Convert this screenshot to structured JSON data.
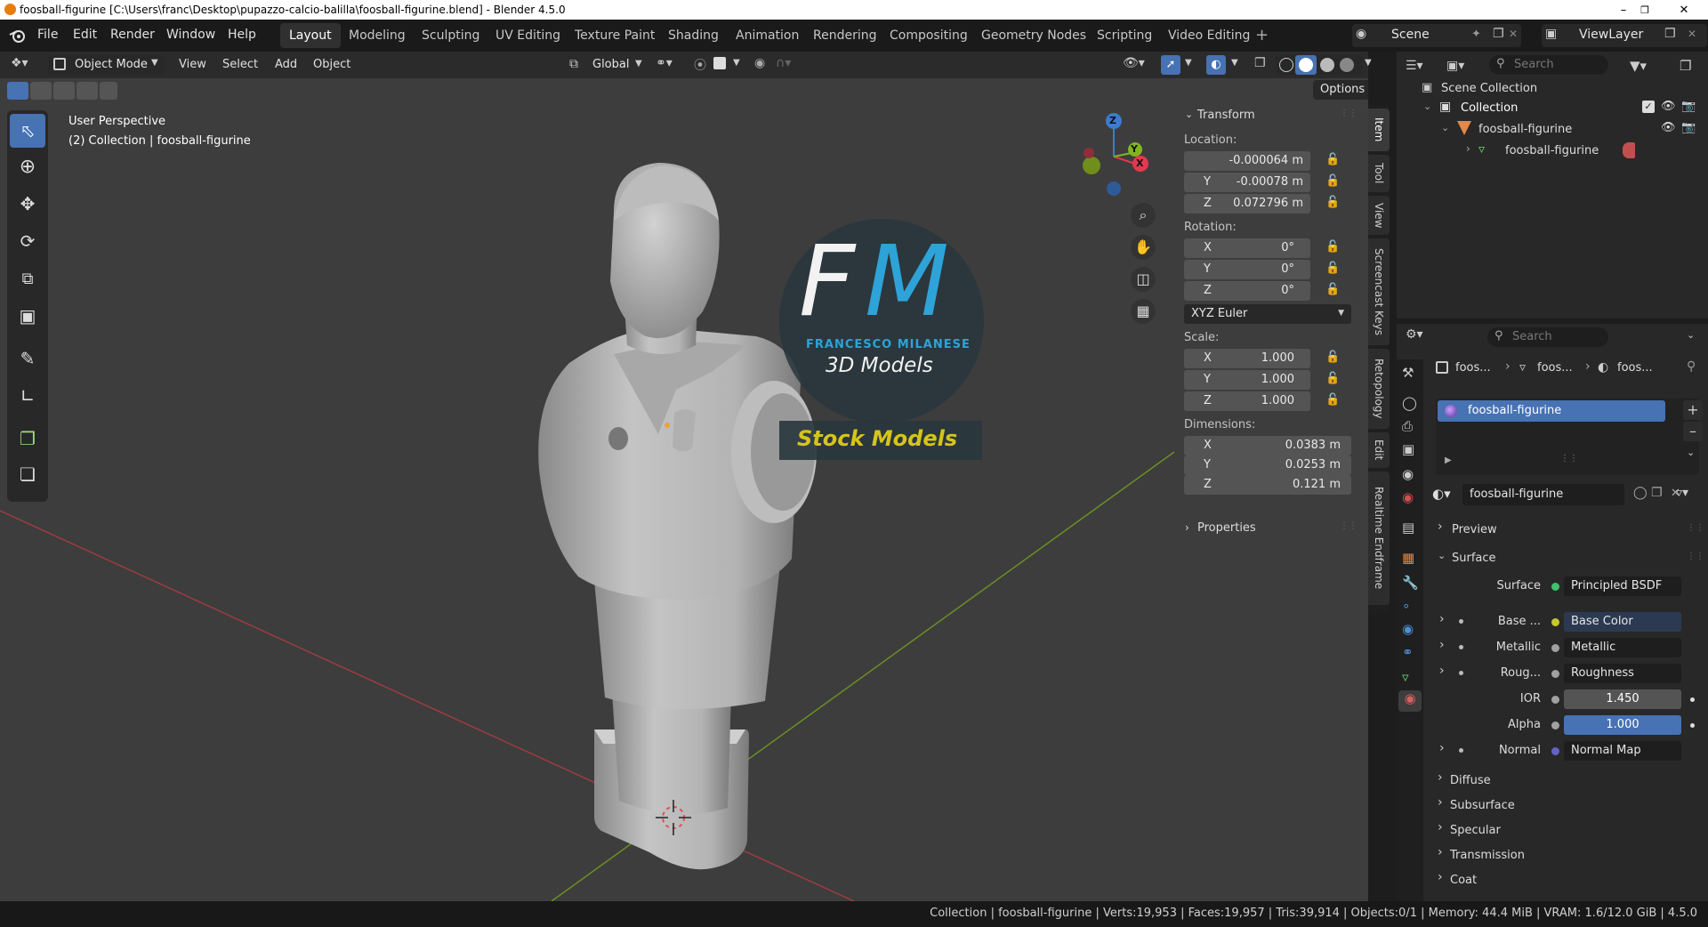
{
  "window": {
    "title": "foosball-figurine [C:\\Users\\franc\\Desktop\\pupazzo-calcio-balilla\\foosball-figurine.blend] - Blender 4.5.0"
  },
  "menu": {
    "items": [
      "File",
      "Edit",
      "Render",
      "Window",
      "Help"
    ]
  },
  "workspaces": [
    "Layout",
    "Modeling",
    "Sculpting",
    "UV Editing",
    "Texture Paint",
    "Shading",
    "Animation",
    "Rendering",
    "Compositing",
    "Geometry Nodes",
    "Scripting",
    "Video Editing"
  ],
  "active_workspace": "Layout",
  "top_right": {
    "scene": "Scene",
    "view_layer": "ViewLayer"
  },
  "viewport_header": {
    "mode": "Object Mode",
    "menus": [
      "View",
      "Select",
      "Add",
      "Object"
    ],
    "orientation": "Global",
    "options": "Options"
  },
  "viewport": {
    "perspective": "User Perspective",
    "collection_info": "(2) Collection | foosball-figurine"
  },
  "gizmo": {
    "x": "X",
    "y": "Y",
    "z": "Z"
  },
  "watermark": {
    "initials_f": "F",
    "initials_m": "M",
    "name": "FRANCESCO MILANESE",
    "subtitle": "3D Models",
    "banner": "Stock Models"
  },
  "npanel": {
    "transform_title": "Transform",
    "location_label": "Location:",
    "location": [
      {
        "axis": "",
        "value": "-0.000064 m"
      },
      {
        "axis": "Y",
        "value": "-0.00078 m"
      },
      {
        "axis": "Z",
        "value": "0.072796 m"
      }
    ],
    "rotation_label": "Rotation:",
    "rotation": [
      {
        "axis": "X",
        "value": "0°"
      },
      {
        "axis": "Y",
        "value": "0°"
      },
      {
        "axis": "Z",
        "value": "0°"
      }
    ],
    "rotation_mode": "XYZ Euler",
    "scale_label": "Scale:",
    "scale": [
      {
        "axis": "X",
        "value": "1.000"
      },
      {
        "axis": "Y",
        "value": "1.000"
      },
      {
        "axis": "Z",
        "value": "1.000"
      }
    ],
    "dimensions_label": "Dimensions:",
    "dimensions": [
      {
        "axis": "X",
        "value": "0.0383 m"
      },
      {
        "axis": "Y",
        "value": "0.0253 m"
      },
      {
        "axis": "Z",
        "value": "0.121 m"
      }
    ],
    "properties_title": "Properties"
  },
  "side_tabs": [
    "Item",
    "Tool",
    "View",
    "Screencast Keys",
    "Retopology",
    "Edit",
    "Realtime Endframe"
  ],
  "outliner": {
    "search_placeholder": "Search",
    "scene_collection": "Scene Collection",
    "collection": "Collection",
    "object": "foosball-figurine",
    "mesh": "foosball-figurine"
  },
  "properties": {
    "search_placeholder": "Search",
    "breadcrumb": [
      "foos...",
      "foos...",
      "foos..."
    ],
    "slot": "foosball-figurine",
    "material_name": "foosball-figurine",
    "preview": "Preview",
    "surface_section": "Surface",
    "rows": [
      {
        "label": "Surface",
        "value": "Principled BSDF",
        "dot": "#3fbf6f",
        "expander": false,
        "kind": "drop"
      },
      {
        "label": "Base ...",
        "value": "Base Color",
        "dot": "#c7c729",
        "expander": true,
        "kind": "drop"
      },
      {
        "label": "Metallic",
        "value": "Metallic",
        "dot": "#a1a1a1",
        "expander": true,
        "kind": "drop"
      },
      {
        "label": "Roug...",
        "value": "Roughness",
        "dot": "#a1a1a1",
        "expander": true,
        "kind": "drop"
      },
      {
        "label": "IOR",
        "value": "1.450",
        "dot": "#a1a1a1",
        "expander": false,
        "kind": "num"
      },
      {
        "label": "Alpha",
        "value": "1.000",
        "dot": "#a1a1a1",
        "expander": false,
        "kind": "bar"
      },
      {
        "label": "Normal",
        "value": "Normal Map",
        "dot": "#6363c7",
        "expander": true,
        "kind": "drop"
      }
    ],
    "subpanels": [
      "Diffuse",
      "Subsurface",
      "Specular",
      "Transmission",
      "Coat"
    ]
  },
  "statusbar": {
    "text": "Collection | foosball-figurine | Verts:19,953 | Faces:19,957 | Tris:39,914 | Objects:0/1 | Memory: 44.4 MiB | VRAM: 1.6/12.0 GiB | 4.5.0"
  },
  "colors": {
    "accent": "#4772b3",
    "fm_blue": "#2ea3d8",
    "banner_yellow": "#d6c41a"
  }
}
